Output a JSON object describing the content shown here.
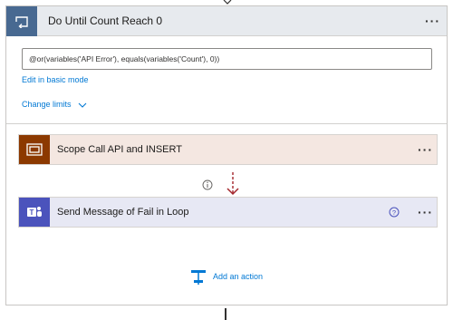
{
  "loop": {
    "title": "Do Until Count Reach 0",
    "condition_value": "@or(variables('API Error'), equals(variables('Count'), 0))",
    "edit_basic_mode_label": "Edit in basic mode",
    "change_limits_label": "Change limits",
    "more_label": "···",
    "icon": "do-until-loop-icon"
  },
  "actions": [
    {
      "title": "Scope Call API and INSERT",
      "icon": "scope-icon",
      "color": "#8c3900",
      "more_label": "···"
    },
    {
      "title": "Send Message of Fail in Loop",
      "icon": "teams-icon",
      "color": "#4b53bc",
      "more_label": "···"
    }
  ],
  "add_action_label": "Add an action",
  "colors": {
    "accent": "#0078d4",
    "loop_header": "#486991",
    "run_after_arrow": "#a4262c"
  }
}
